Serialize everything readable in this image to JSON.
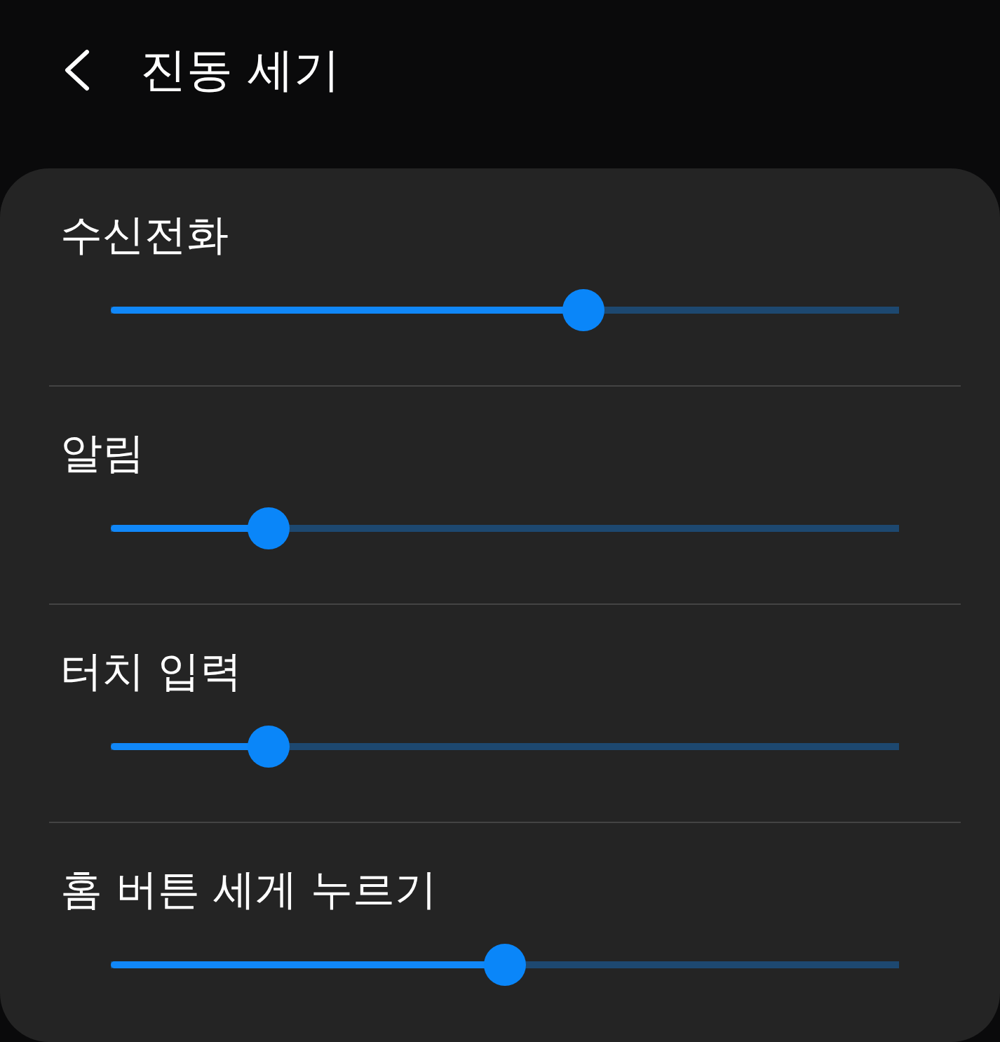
{
  "header": {
    "title": "진동 세기"
  },
  "sliders": [
    {
      "label": "수신전화",
      "level": 0.6
    },
    {
      "label": "알림",
      "level": 0.2
    },
    {
      "label": "터치 입력",
      "level": 0.2
    },
    {
      "label": "홈 버튼 세게 누르기",
      "level": 0.5
    }
  ]
}
